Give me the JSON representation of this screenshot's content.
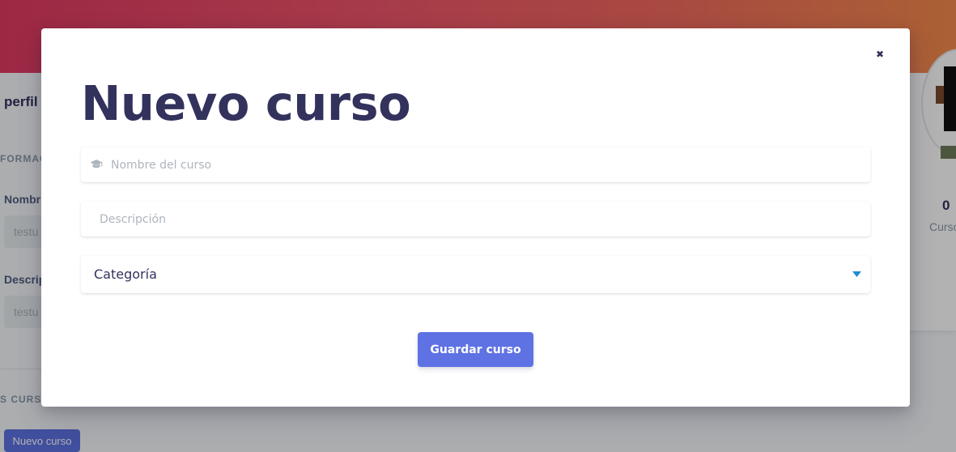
{
  "background": {
    "profile_title": "perfil",
    "info_section": "FORMACI",
    "name_label": "Nombr",
    "name_value": "testu",
    "description_label": "Descrip",
    "description_value": "testu",
    "courses_section": "S CURSO",
    "new_course_button": "Nuevo curso",
    "stat_value": "0",
    "stat_label": "Curso"
  },
  "modal": {
    "title": "Nuevo curso",
    "close_symbol": "✖",
    "course_name_placeholder": "Nombre del curso",
    "course_name_icon": "graduation-cap-icon",
    "description_placeholder": "Descripción",
    "category_value": "Categoría",
    "save_button": "Guardar curso"
  },
  "colors": {
    "primary": "#5e72e4",
    "heading": "#32325d",
    "caret": "#1a8fd1",
    "hero_start": "#e13a63",
    "hero_end": "#f58b4c"
  }
}
